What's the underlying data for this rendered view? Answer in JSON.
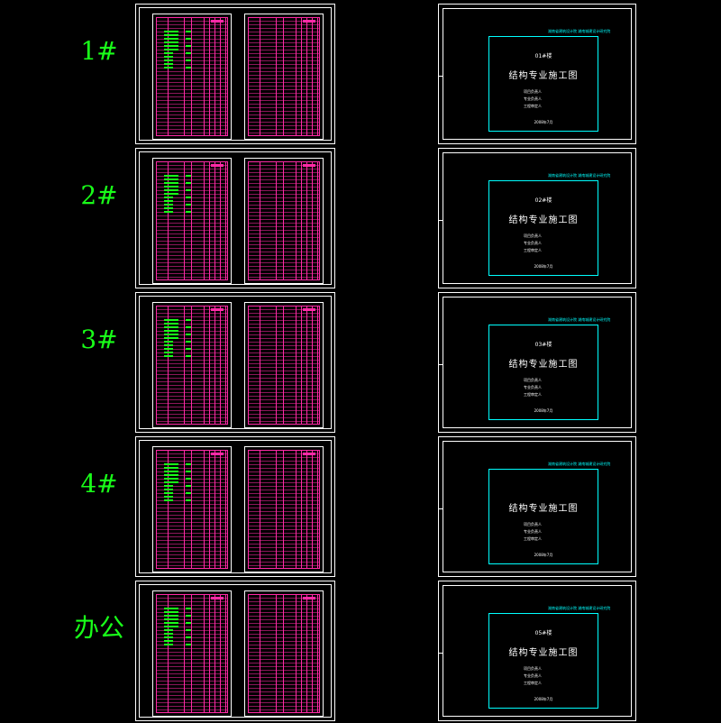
{
  "rows": [
    {
      "label": "1#",
      "building": "01#楼"
    },
    {
      "label": "2#",
      "building": "02#楼"
    },
    {
      "label": "3#",
      "building": "03#楼"
    },
    {
      "label": "4#",
      "building": ""
    },
    {
      "label": "办公",
      "building": "05#楼"
    }
  ],
  "cover": {
    "header_note": "湖南省建筑设计院 湖南城建设计研究院",
    "main_title": "结构专业施工图",
    "sig1": "项目负责人",
    "sig2": "专业负责人",
    "sig3": "工程审定人",
    "date": "2008年7月"
  },
  "colors": {
    "label": "#19ff19",
    "grid": "#ff2aa6",
    "cover_frame": "#00ffff",
    "line": "#ffffff"
  }
}
